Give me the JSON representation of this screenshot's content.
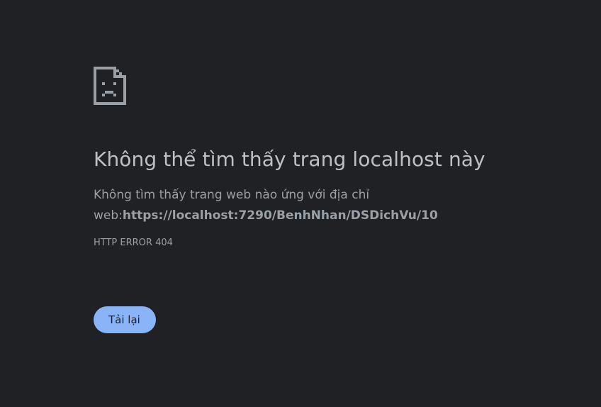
{
  "icon": {
    "name": "sad-document-icon"
  },
  "heading": "Không thể tìm thấy trang localhost này",
  "message": {
    "prefix": "Không tìm thấy trang web nào ứng với địa chỉ web:",
    "url": "https://localhost:7290/BenhNhan/DSDichVu/10"
  },
  "error_code": "HTTP ERROR 404",
  "reload_button": {
    "label": "Tải lại"
  },
  "colors": {
    "background": "#202124",
    "heading": "#bdc1c6",
    "text": "#9aa0a6",
    "button": "#8ab4f8"
  }
}
